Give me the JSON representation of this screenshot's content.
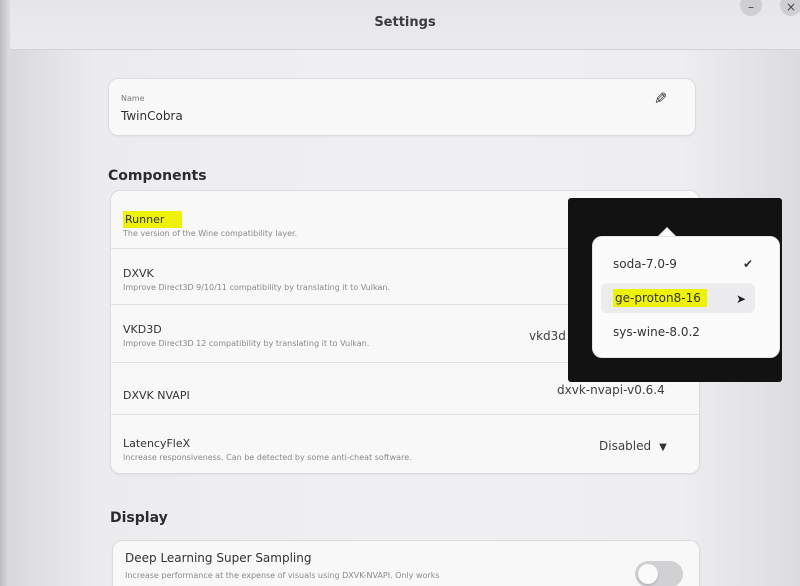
{
  "window": {
    "title": "Settings"
  },
  "name_field": {
    "label": "Name",
    "value": "TwinCobra",
    "edit_icon": "pencil-icon"
  },
  "components": {
    "heading": "Components",
    "rows": [
      {
        "title": "Runner",
        "subtitle": "The version of the Wine compatibility layer.",
        "value": ""
      },
      {
        "title": "DXVK",
        "subtitle": "Improve Direct3D 9/10/11 compatibility by translating it to Vulkan.",
        "value": ""
      },
      {
        "title": "VKD3D",
        "subtitle": "Improve Direct3D 12 compatibility by translating it to Vulkan.",
        "value": "vkd3d"
      },
      {
        "title": "DXVK NVAPI",
        "subtitle": "",
        "value": "dxvk-nvapi-v0.6.4"
      },
      {
        "title": "LatencyFleX",
        "subtitle": "Increase responsiveness. Can be detected by some anti-cheat software.",
        "value": "Disabled"
      }
    ]
  },
  "display": {
    "heading": "Display",
    "rows": [
      {
        "title": "Deep Learning Super Sampling",
        "subtitle": "Increase performance at the expense of visuals using DXVK-NVAPI. Only works"
      }
    ]
  },
  "runner_popover": {
    "options": [
      {
        "label": "soda-7.0-9",
        "checked": true
      },
      {
        "label": "ge-proton8-16",
        "checked": false
      },
      {
        "label": "sys-wine-8.0.2",
        "checked": false
      }
    ]
  },
  "colors": {
    "highlight": "#eef20a",
    "backdrop": "#121212"
  }
}
